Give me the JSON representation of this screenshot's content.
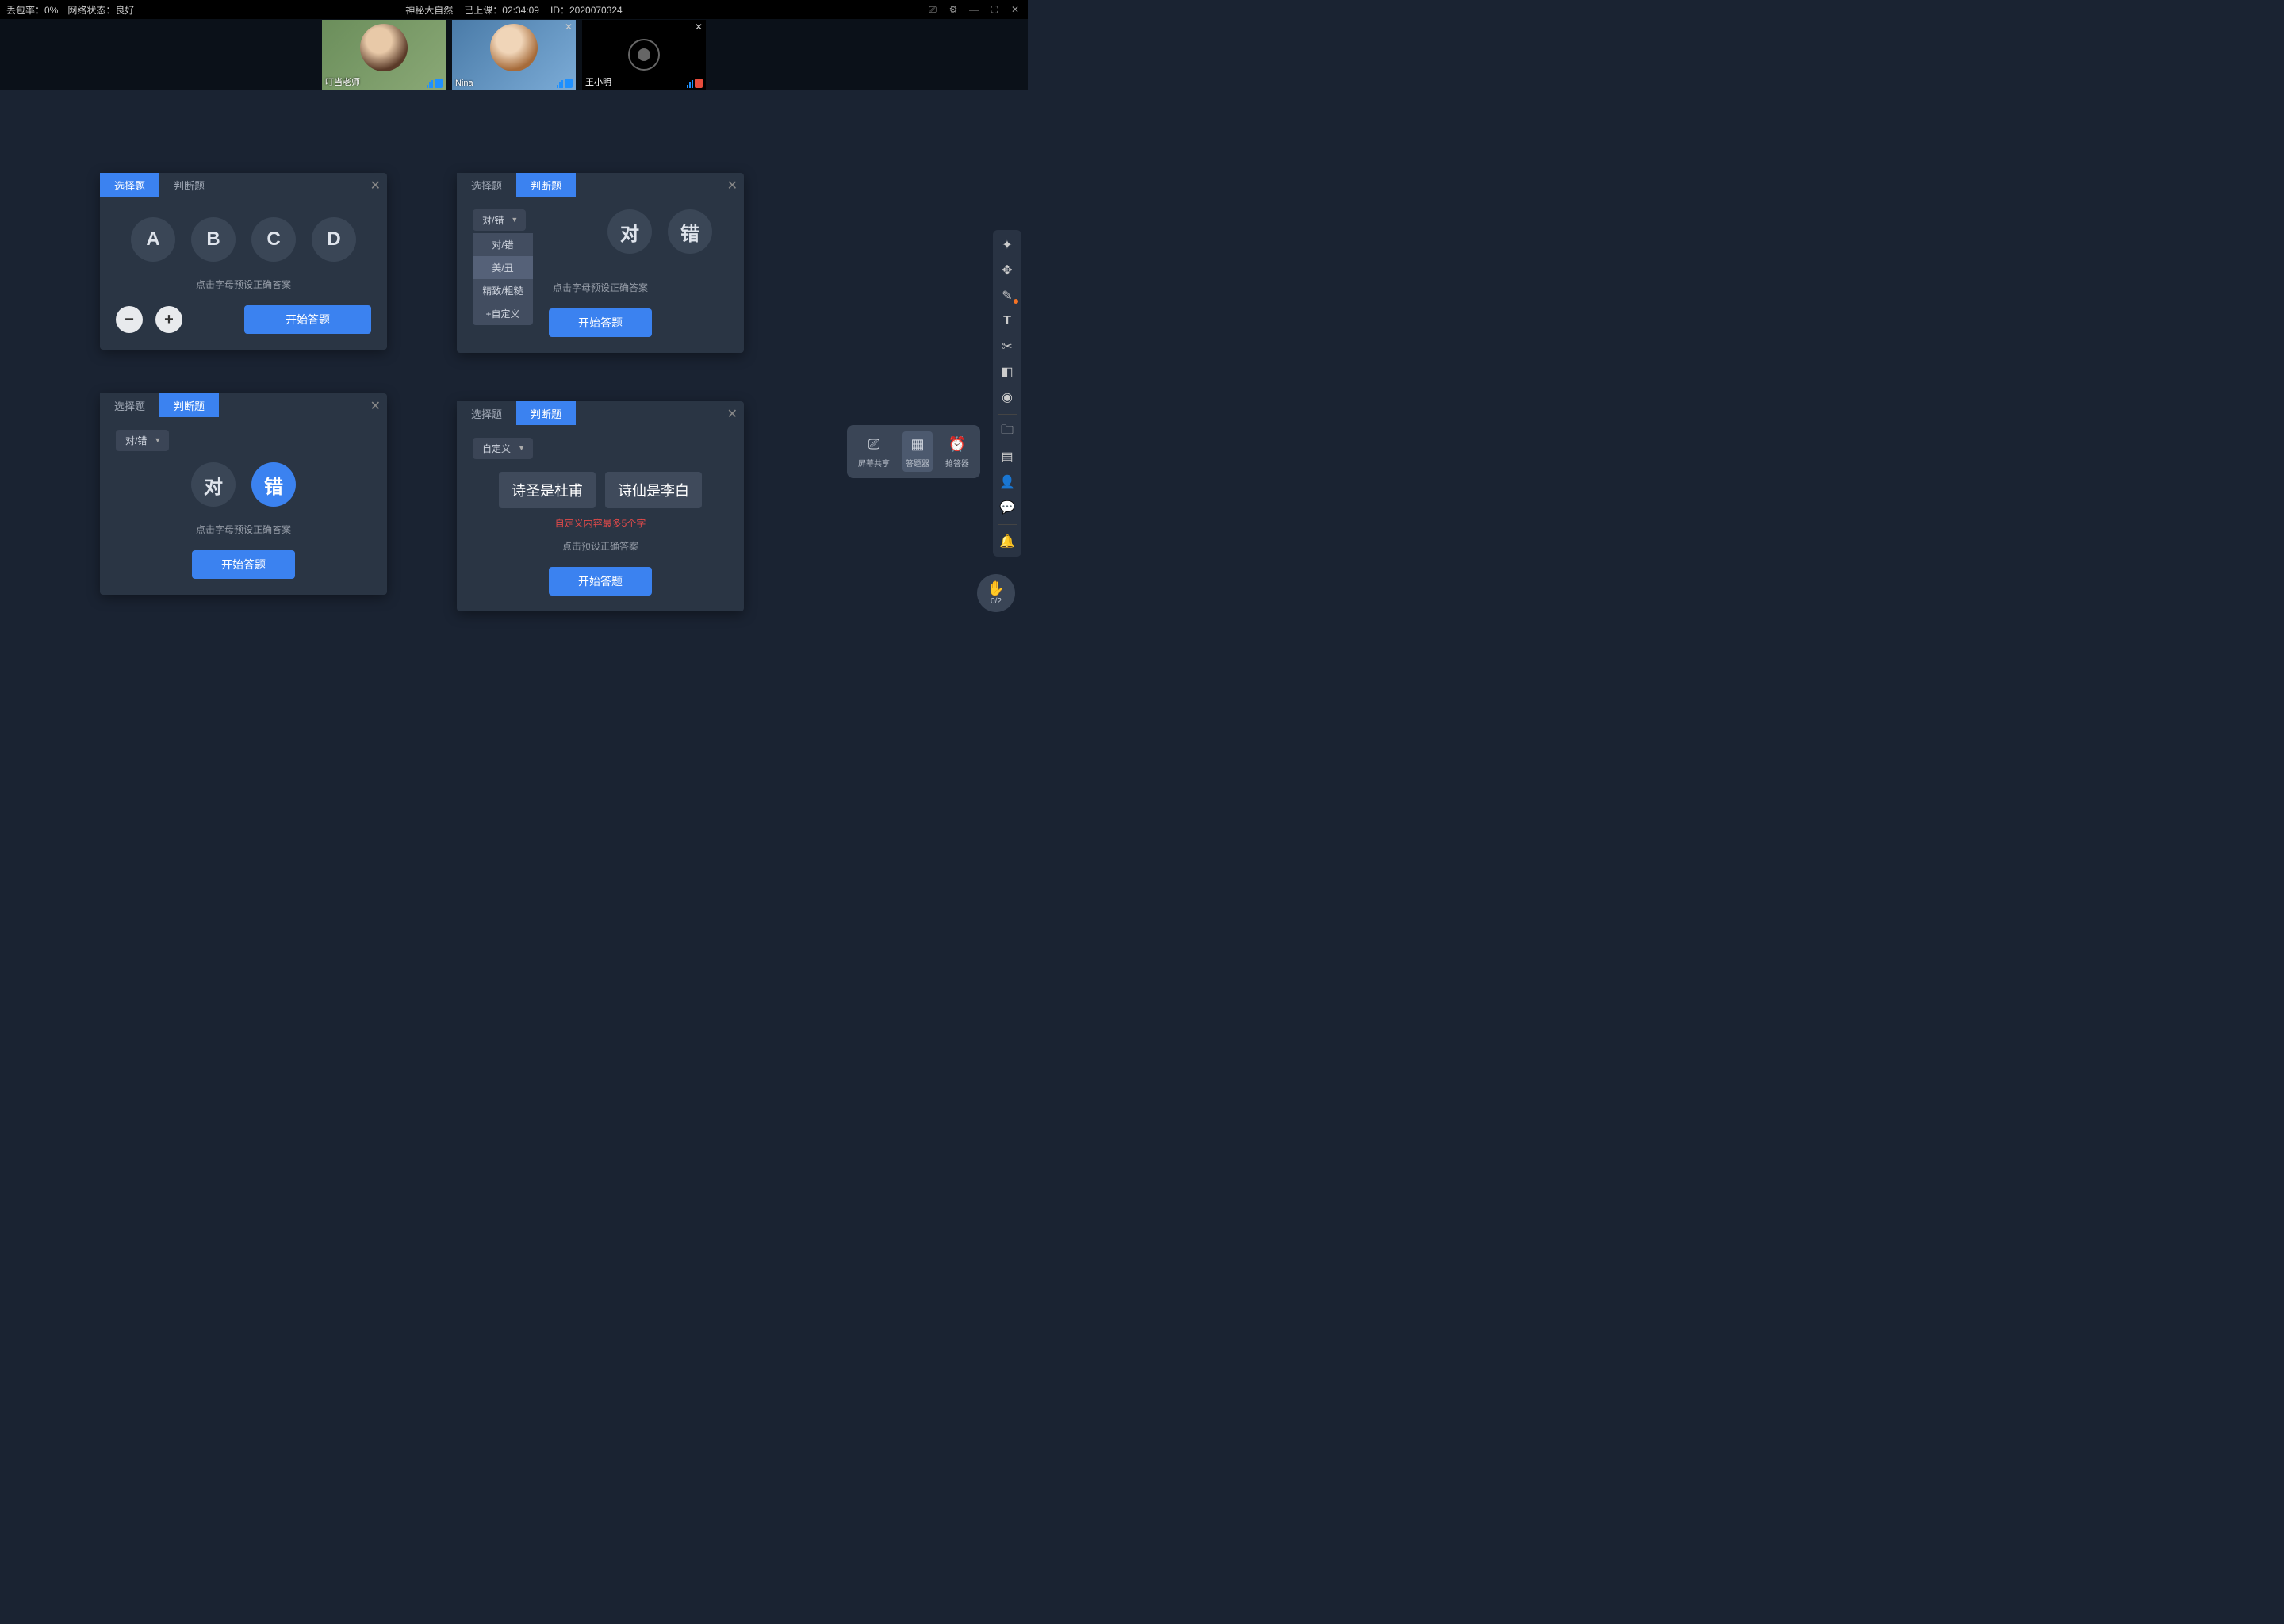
{
  "topbar": {
    "packet_loss_label": "丢包率：0%",
    "network_label": "网络状态：良好",
    "title": "神秘大自然",
    "class_time_label": "已上课：02:34:09",
    "class_id_label": "ID：2020070324"
  },
  "videos": [
    {
      "name": "叮当老师",
      "muted": false,
      "closable": false
    },
    {
      "name": "Nina",
      "muted": false,
      "closable": true
    },
    {
      "name": "王小明",
      "muted": true,
      "closable": true
    }
  ],
  "panel1": {
    "tab1": "选择题",
    "tab2": "判断题",
    "options": [
      "A",
      "B",
      "C",
      "D"
    ],
    "hint": "点击字母预设正确答案",
    "start": "开始答题"
  },
  "panel2": {
    "tab1": "选择题",
    "tab2": "判断题",
    "dropdown_label": "对/错",
    "dropdown_items": [
      "对/错",
      "美/丑",
      "精致/粗糙",
      "+自定义"
    ],
    "opt_a": "对",
    "opt_b": "错",
    "hint": "点击字母预设正确答案",
    "start": "开始答题"
  },
  "panel3": {
    "tab1": "选择题",
    "tab2": "判断题",
    "dropdown_label": "对/错",
    "opt_a": "对",
    "opt_b": "错",
    "hint": "点击字母预设正确答案",
    "start": "开始答题"
  },
  "panel4": {
    "tab1": "选择题",
    "tab2": "判断题",
    "dropdown_label": "自定义",
    "tag_a": "诗圣是杜甫",
    "tag_b": "诗仙是李白",
    "warn": "自定义内容最多5个字",
    "hint": "点击预设正确答案",
    "start": "开始答题"
  },
  "floatbar": {
    "share": "屏幕共享",
    "answer": "答题器",
    "buzzer": "抢答器"
  },
  "hand": {
    "count": "0/2"
  }
}
